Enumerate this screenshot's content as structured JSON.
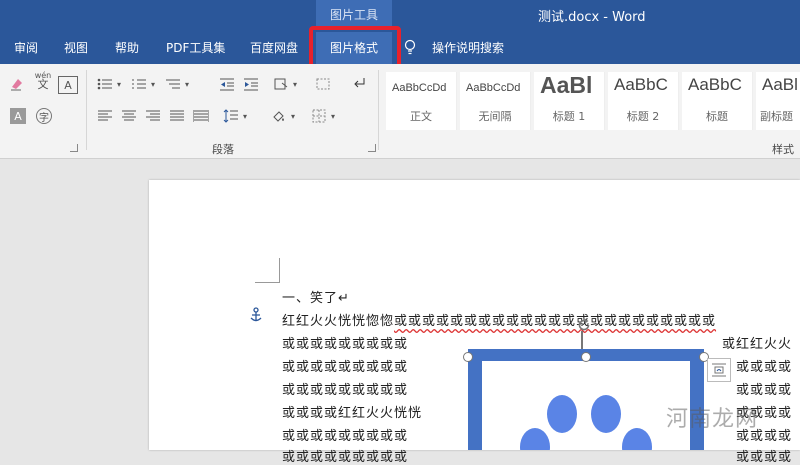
{
  "window": {
    "context_tab_group": "图片工具",
    "doc_title": "测试.docx  -  Word"
  },
  "tabs": [
    {
      "label": "审阅"
    },
    {
      "label": "视图"
    },
    {
      "label": "帮助"
    },
    {
      "label": "PDF工具集"
    },
    {
      "label": "百度网盘"
    },
    {
      "label": "图片格式"
    },
    {
      "label": "操作说明搜索"
    }
  ],
  "ribbon": {
    "paragraph_group_label": "段落",
    "styles_group_label": "样式",
    "styles": [
      {
        "sample": "AaBbCcDd",
        "name": "正文"
      },
      {
        "sample": "AaBbCcDd",
        "name": "无间隔"
      },
      {
        "sample": "AaBl",
        "name": "标题 1"
      },
      {
        "sample": "AaBbC",
        "name": "标题 2"
      },
      {
        "sample": "AaBbC",
        "name": "标题"
      },
      {
        "sample": "AaBl",
        "name": "副标题"
      }
    ],
    "font_pinyin_label": "wén",
    "font_char_label": "文",
    "font_box_label": "A"
  },
  "document": {
    "heading_line": "一、笑了↵",
    "line1_prefix": "红红火火恍恍惚惚",
    "line1_wavy": "或或或或或或或或或或或或或或或或或或或或或或或",
    "left_lines": [
      "或或或或或或或或或",
      "或或或或或或或或或",
      "或或或或或或或或或",
      "或或或或红红火火恍恍",
      "或或或或或或或或或",
      "或或或或或或或或或"
    ],
    "right_lines": [
      "或红红火火",
      "或或或或",
      "或或或或",
      "或或或或",
      "或或或或",
      "或或或或"
    ]
  },
  "watermark": "河南龙网",
  "colors": {
    "title_bar": "#2b579a",
    "active_tab": "#3e6db5",
    "highlight_box": "#e8212c",
    "picture_frame": "#4472c4",
    "paw": "#5a84e6"
  }
}
